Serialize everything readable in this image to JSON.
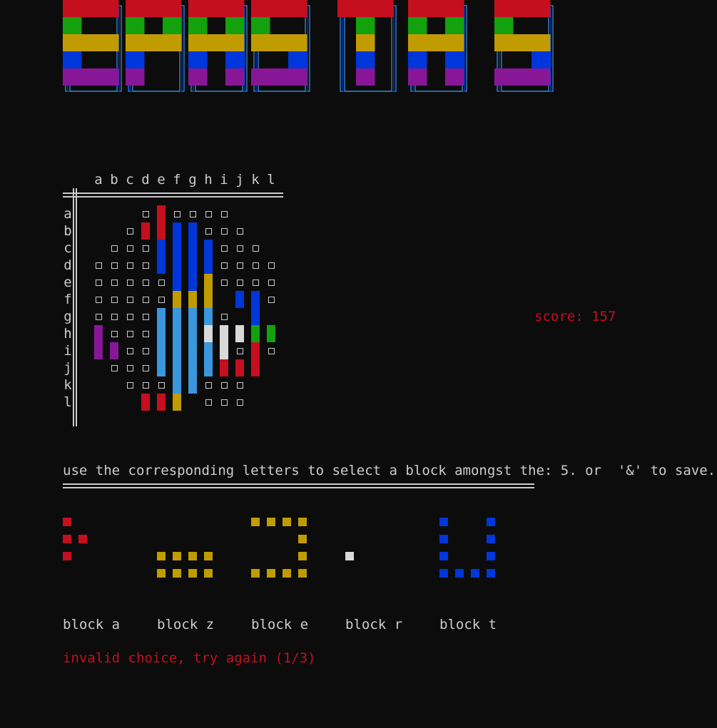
{
  "colors": {
    "red": "#c50f1f",
    "green": "#13a10e",
    "yellow": "#c19c00",
    "blue": "#0037da",
    "purple": "#881798",
    "cyan": "#3a96dd",
    "white": "#cccccc",
    "light": "#d9d9d9",
    "background": "#0c0c0c"
  },
  "board": {
    "column_letters": [
      "a",
      "b",
      "c",
      "d",
      "e",
      "f",
      "g",
      "h",
      "i",
      "j",
      "k",
      "l"
    ],
    "row_letters": [
      "a",
      "b",
      "c",
      "d",
      "e",
      "f",
      "g",
      "h",
      "i",
      "j",
      "k",
      "l"
    ],
    "empty_rows": [
      "...x.xxxx...",
      "..x....xxx..",
      ".xxx...xxxx.",
      "xxxx...xxxxx",
      "xxxxx..xxxxx",
      "xxxxx..x.x.x",
      "xxxx...xx.x.",
      ".xxx........",
      ".xxx.....x.x",
      ".xxx........",
      "..xxx..xxx..",
      ".....x.xxx.."
    ],
    "blocks": [
      {
        "col": "e",
        "from": "a",
        "to": "b",
        "color": "red"
      },
      {
        "col": "d",
        "from": "b",
        "to": "b",
        "color": "red"
      },
      {
        "col": "e",
        "from": "c",
        "to": "d",
        "color": "blue"
      },
      {
        "col": "f",
        "from": "b",
        "to": "e",
        "color": "blue"
      },
      {
        "col": "g",
        "from": "b",
        "to": "e",
        "color": "blue"
      },
      {
        "col": "h",
        "from": "c",
        "to": "d",
        "color": "blue"
      },
      {
        "col": "f",
        "from": "f",
        "to": "f",
        "color": "yellow"
      },
      {
        "col": "g",
        "from": "f",
        "to": "f",
        "color": "yellow"
      },
      {
        "col": "h",
        "from": "e",
        "to": "f",
        "color": "yellow"
      },
      {
        "col": "e",
        "from": "g",
        "to": "j",
        "color": "cyan"
      },
      {
        "col": "f",
        "from": "g",
        "to": "k",
        "color": "cyan"
      },
      {
        "col": "g",
        "from": "g",
        "to": "k",
        "color": "cyan"
      },
      {
        "col": "h",
        "from": "g",
        "to": "g",
        "color": "cyan"
      },
      {
        "col": "h",
        "from": "i",
        "to": "j",
        "color": "cyan"
      },
      {
        "col": "h",
        "from": "h",
        "to": "h",
        "color": "light"
      },
      {
        "col": "i",
        "from": "h",
        "to": "i",
        "color": "light"
      },
      {
        "col": "j",
        "from": "h",
        "to": "h",
        "color": "light"
      },
      {
        "col": "j",
        "from": "f",
        "to": "f",
        "color": "blue"
      },
      {
        "col": "k",
        "from": "f",
        "to": "g",
        "color": "blue"
      },
      {
        "col": "k",
        "from": "h",
        "to": "h",
        "color": "green"
      },
      {
        "col": "l",
        "from": "h",
        "to": "h",
        "color": "green"
      },
      {
        "col": "k",
        "from": "i",
        "to": "j",
        "color": "red"
      },
      {
        "col": "i",
        "from": "j",
        "to": "j",
        "color": "red"
      },
      {
        "col": "j",
        "from": "j",
        "to": "j",
        "color": "red"
      },
      {
        "col": "a",
        "from": "h",
        "to": "i",
        "color": "purple"
      },
      {
        "col": "b",
        "from": "i",
        "to": "i",
        "color": "purple"
      },
      {
        "col": "d",
        "from": "l",
        "to": "l",
        "color": "red"
      },
      {
        "col": "e",
        "from": "l",
        "to": "l",
        "color": "red"
      },
      {
        "col": "f",
        "from": "l",
        "to": "l",
        "color": "yellow"
      }
    ]
  },
  "score_text": "score: 157",
  "instruction": "use the corresponding letters to select a block amongst the: 5. or  '&' to save.",
  "pieces": [
    {
      "label": "block a",
      "color": "red",
      "cells": [
        [
          0,
          0
        ],
        [
          0,
          1
        ],
        [
          1,
          1
        ],
        [
          0,
          2
        ]
      ]
    },
    {
      "label": "block z",
      "color": "yellow",
      "cells": [
        [
          0,
          2
        ],
        [
          1,
          2
        ],
        [
          2,
          2
        ],
        [
          3,
          2
        ],
        [
          0,
          3
        ],
        [
          1,
          3
        ],
        [
          2,
          3
        ],
        [
          3,
          3
        ]
      ]
    },
    {
      "label": "block e",
      "color": "yellow",
      "cells": [
        [
          0,
          0
        ],
        [
          1,
          0
        ],
        [
          2,
          0
        ],
        [
          3,
          0
        ],
        [
          3,
          1
        ],
        [
          3,
          2
        ],
        [
          0,
          3
        ],
        [
          1,
          3
        ],
        [
          2,
          3
        ],
        [
          3,
          3
        ]
      ]
    },
    {
      "label": "block r",
      "color": "light",
      "cells": [
        [
          0,
          2
        ]
      ]
    },
    {
      "label": "block t",
      "color": "blue",
      "cells": [
        [
          0,
          0
        ],
        [
          3,
          0
        ],
        [
          0,
          1
        ],
        [
          3,
          1
        ],
        [
          0,
          2
        ],
        [
          3,
          2
        ],
        [
          0,
          3
        ],
        [
          1,
          3
        ],
        [
          2,
          3
        ],
        [
          3,
          3
        ]
      ]
    }
  ],
  "error_text": "invalid choice, try again (1/3)"
}
